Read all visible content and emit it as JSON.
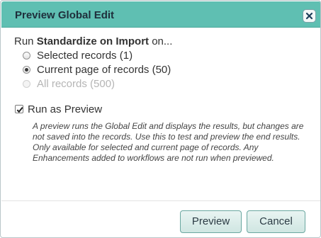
{
  "dialog": {
    "title": "Preview Global Edit",
    "colors": {
      "titlebar": "#5fbfb2",
      "button": "#cfe6e2"
    }
  },
  "run_line": {
    "prefix": "Run ",
    "edit_name": "Standardize on Import",
    "suffix": " on..."
  },
  "scope_options": [
    {
      "label": "Selected records (1)",
      "checked": false,
      "disabled": false
    },
    {
      "label": "Current page of records (50)",
      "checked": true,
      "disabled": false
    },
    {
      "label": "All records (500)",
      "checked": false,
      "disabled": true
    }
  ],
  "run_as_preview": {
    "label": "Run as Preview",
    "checked": true,
    "help_text": "A preview runs the Global Edit and displays the results, but changes are not saved into the records. Use this to test and preview the end results. Only available for selected and current page of records. Any Enhancements added to workflows are not run when previewed."
  },
  "buttons": {
    "preview": "Preview",
    "cancel": "Cancel"
  },
  "icons": {
    "close": "close-icon",
    "check": "checkmark-icon"
  }
}
